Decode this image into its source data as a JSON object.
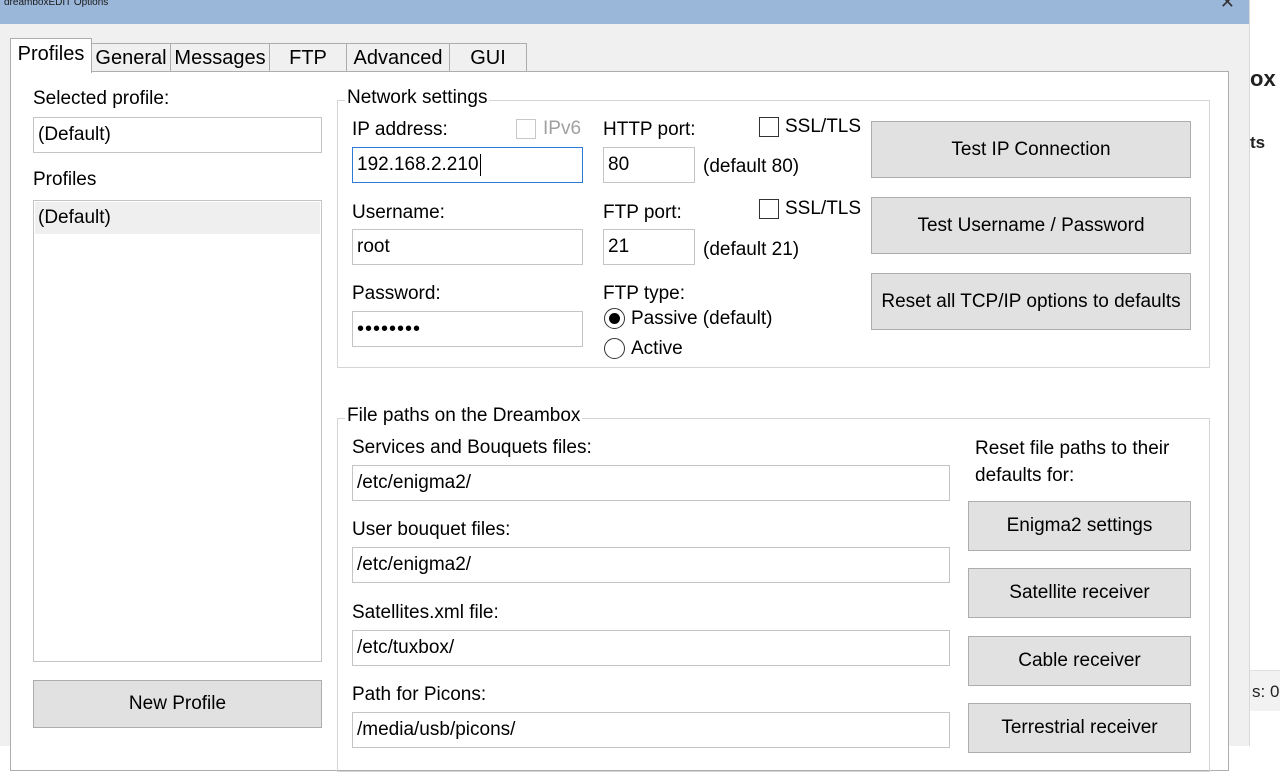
{
  "window": {
    "title": "dreamboxEDIT Options",
    "close_glyph": "✕"
  },
  "tabs": [
    {
      "label": "Profiles",
      "active": true
    },
    {
      "label": "General"
    },
    {
      "label": "Messages"
    },
    {
      "label": "FTP"
    },
    {
      "label": "Advanced"
    },
    {
      "label": "GUI"
    }
  ],
  "profiles": {
    "selected_label": "Selected profile:",
    "selected_value": "(Default)",
    "list_label": "Profiles",
    "items": [
      "(Default)"
    ],
    "new_button": "New Profile"
  },
  "network": {
    "title": "Network settings",
    "ip_label": "IP address:",
    "ipv6_label": "IPv6",
    "ip_value": "192.168.2.210",
    "http_label": "HTTP port:",
    "http_ssl_label": "SSL/TLS",
    "http_value": "80",
    "http_default": "(default 80)",
    "username_label": "Username:",
    "username_value": "root",
    "ftp_label": "FTP port:",
    "ftp_ssl_label": "SSL/TLS",
    "ftp_value": "21",
    "ftp_default": "(default 21)",
    "password_label": "Password:",
    "password_value": "••••••••",
    "ftp_type_label": "FTP type:",
    "passive_label": "Passive (default)",
    "active_label": "Active",
    "ftp_type_selected": "Passive (default)",
    "test_ip_button": "Test IP Connection",
    "test_user_button": "Test Username / Password",
    "reset_tcp_button": "Reset all TCP/IP options to defaults"
  },
  "paths": {
    "title": "File paths on the Dreambox",
    "services_label": "Services and Bouquets files:",
    "services_value": "/etc/enigma2/",
    "user_bouquet_label": "User bouquet files:",
    "user_bouquet_value": "/etc/enigma2/",
    "satellites_label": "Satellites.xml file:",
    "satellites_value": "/etc/tuxbox/",
    "picons_label": "Path for Picons:",
    "picons_value": "/media/usb/picons/",
    "reset_label": "Reset file paths to their defaults for:",
    "enigma2_button": "Enigma2 settings",
    "satellite_button": "Satellite receiver",
    "cable_button": "Cable receiver",
    "terrestrial_button": "Terrestrial receiver"
  },
  "background_window": {
    "frag_top": "ox",
    "frag_mid": "ts",
    "frag_status": "s: 0"
  }
}
